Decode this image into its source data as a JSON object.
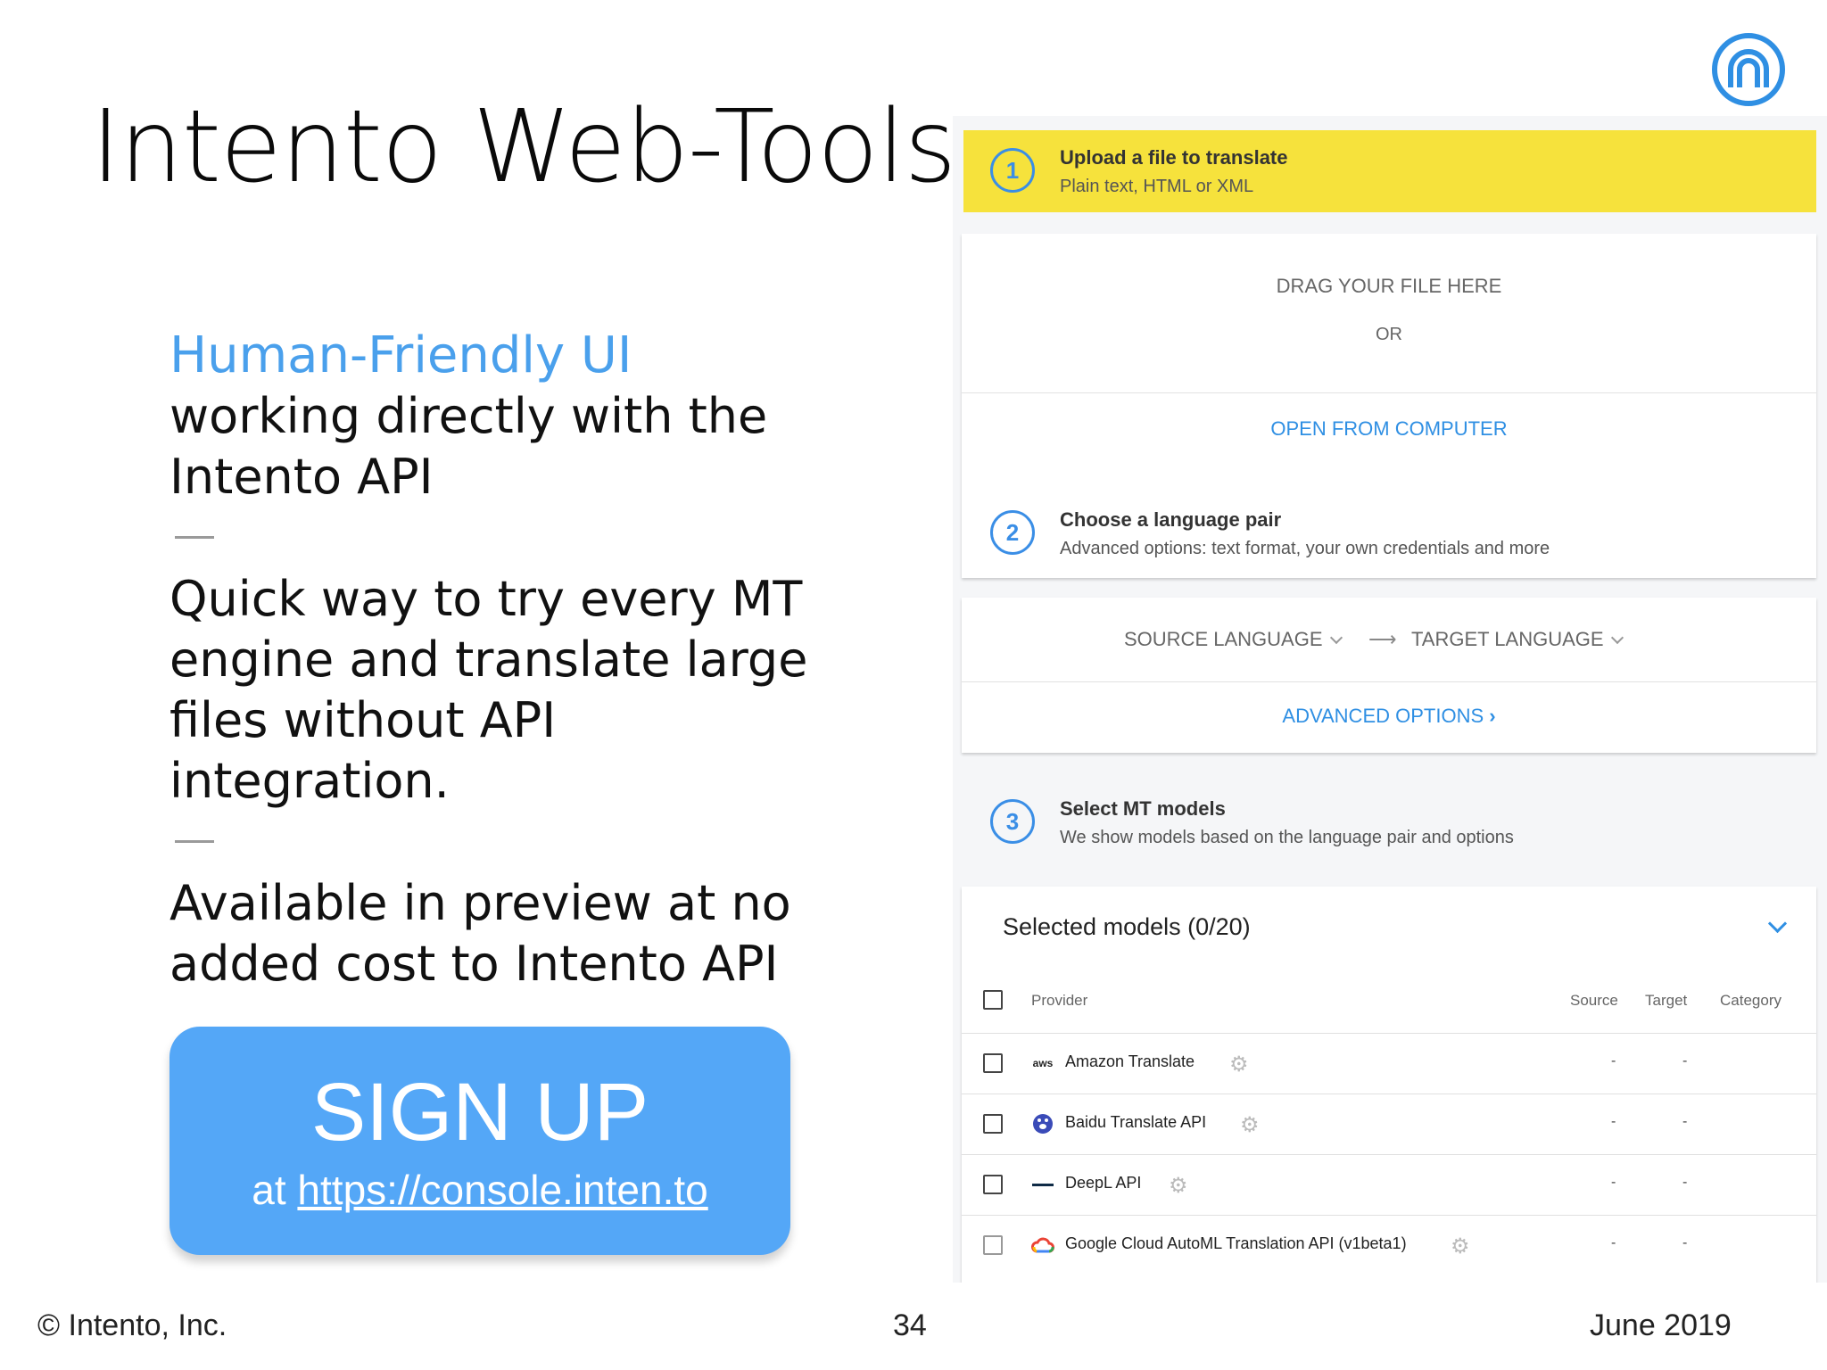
{
  "slide": {
    "title": "Intento Web-Tools",
    "highlight": "Human-Friendly UI",
    "line1": "working directly with the Intento API",
    "dash": "—",
    "para2": "Quick way to try every MT engine and translate large files without API integration.",
    "para3": "Available in preview at no added cost to Intento API",
    "signup_title": "SIGN UP",
    "signup_prefix": "at",
    "signup_link": "https://console.inten.to"
  },
  "footer": {
    "copyright": "© Intento, Inc.",
    "page_number": "34",
    "date": "June 2019"
  },
  "ui": {
    "step1": {
      "number": "1",
      "title": "Upload a file to translate",
      "subtitle": "Plain text, HTML or XML"
    },
    "dropzone": {
      "drag_text": "DRAG YOUR FILE HERE",
      "or_text": "OR",
      "open_button": "OPEN FROM COMPUTER"
    },
    "step2": {
      "number": "2",
      "title": "Choose a language pair",
      "subtitle": "Advanced options: text format, your own credentials and more"
    },
    "language": {
      "source_label": "SOURCE LANGUAGE",
      "target_label": "TARGET LANGUAGE",
      "advanced_label": "ADVANCED OPTIONS"
    },
    "step3": {
      "number": "3",
      "title": "Select MT models",
      "subtitle": "We show models based on the language pair and options"
    },
    "models": {
      "title": "Selected models (0/20)",
      "columns": {
        "provider": "Provider",
        "source": "Source",
        "target": "Target",
        "category": "Category"
      },
      "rows": [
        {
          "provider": "Amazon Translate",
          "icon": "aws-logo-icon",
          "source": "-",
          "target": "-"
        },
        {
          "provider": "Baidu Translate API",
          "icon": "baidu-paw-icon",
          "source": "-",
          "target": "-"
        },
        {
          "provider": "DeepL API",
          "icon": "deepl-logo-icon",
          "source": "-",
          "target": "-"
        },
        {
          "provider": "Google Cloud AutoML Translation API (v1beta1)",
          "icon": "google-cloud-icon",
          "source": "-",
          "target": "-"
        }
      ]
    }
  },
  "colors": {
    "accent_blue": "#4aa0ec",
    "signup_blue": "#54a7f7",
    "step_yellow": "#f6e23c",
    "link_blue": "#2f8fe3"
  }
}
